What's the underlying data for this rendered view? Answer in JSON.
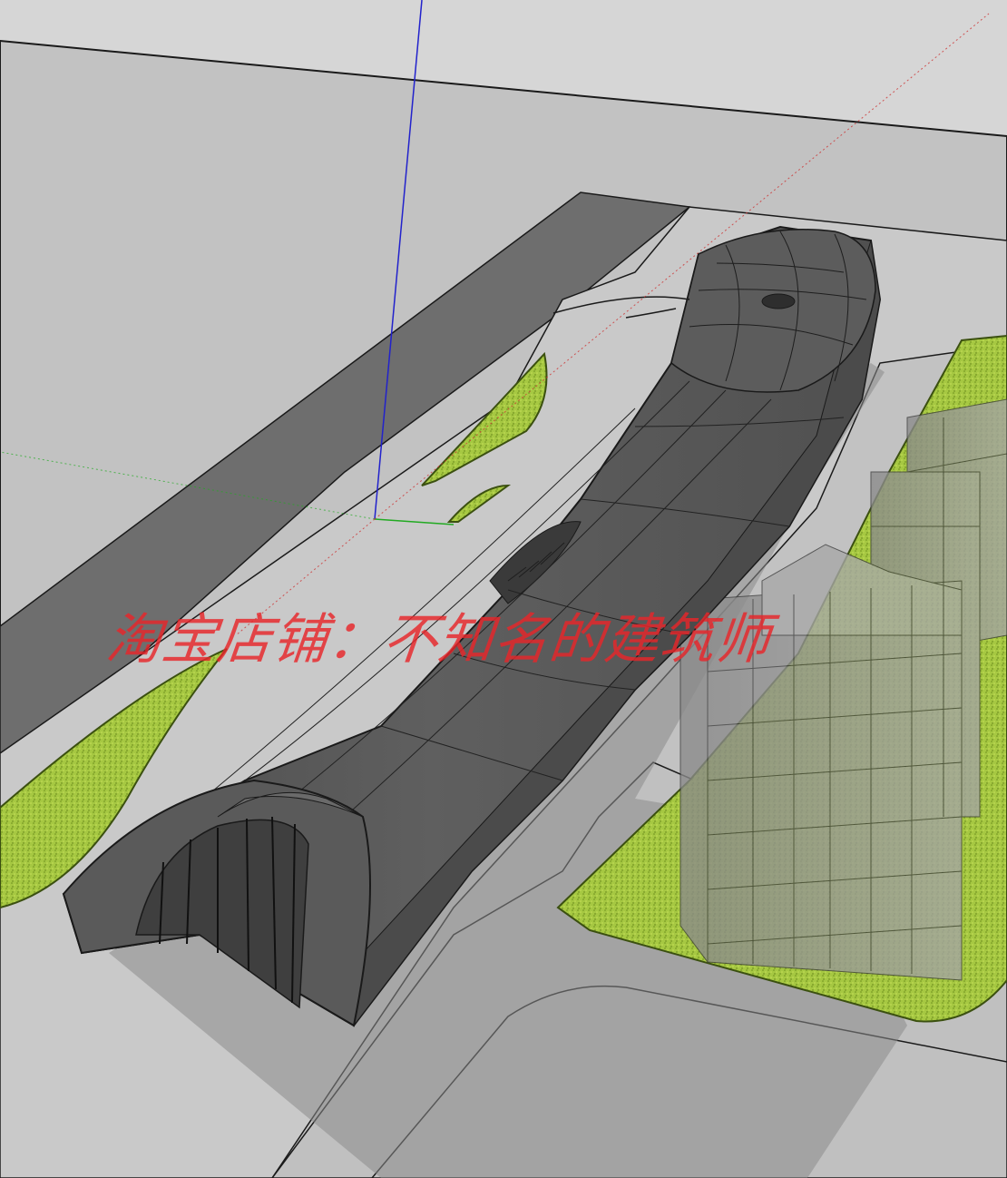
{
  "scene": {
    "colors": {
      "sky": "#d3d3d3",
      "ground": "#c5c5c5",
      "road": "#6f6f6f",
      "building": "#575757",
      "building_shadow": "#4a4a4a",
      "lawn": "#9cc23a",
      "lawn_edge": "#4f6b12",
      "glass_tower": "#9a9a9a",
      "axis_blue": "#2222cc",
      "axis_green": "#22aa22",
      "axis_red": "#cc3333"
    },
    "icons": {
      "model_axes": "axes-icon"
    }
  },
  "watermark": {
    "text": "淘宝店铺：不知名的建筑师",
    "color": "#e8262a"
  }
}
